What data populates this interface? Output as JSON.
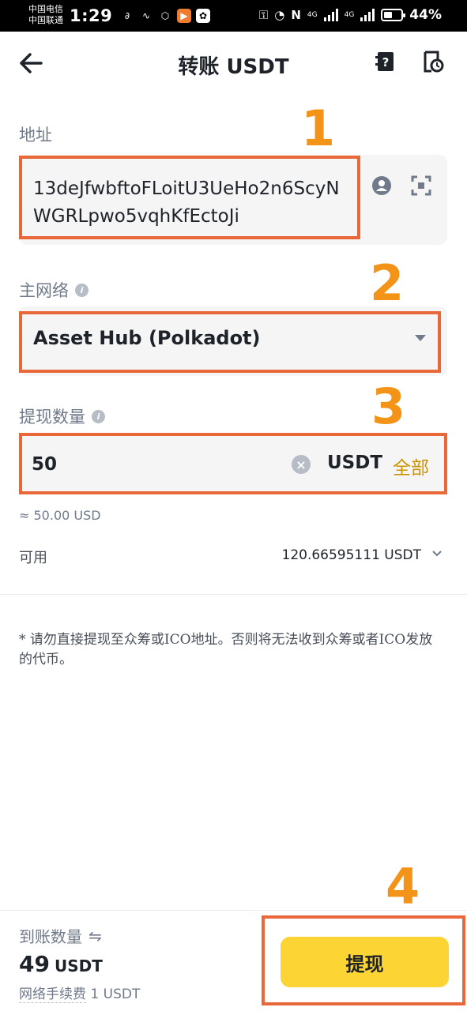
{
  "status_bar": {
    "carrier_1": "中国电信",
    "carrier_2": "中国联通",
    "time": "1:29",
    "network_1": "4G",
    "network_2": "4G",
    "battery": "44%",
    "icons": [
      "key-icon",
      "speed-icon",
      "nfc-icon",
      "signal-icon",
      "battery-icon"
    ]
  },
  "header": {
    "title": "转账 USDT",
    "back_icon": "arrow-left-icon",
    "faq_icon": "question-book-icon",
    "history_icon": "history-icon"
  },
  "address": {
    "label": "地址",
    "value": "13deJfwbftoFLoitU3UeHo2n6ScyNWGRLpwo5vqhKfEctoJi"
  },
  "network": {
    "label": "主网络",
    "value": "Asset Hub (Polkadot)"
  },
  "amount": {
    "label": "提现数量",
    "value": "50",
    "unit": "USDT",
    "max_label": "全部",
    "usd_approx": "≈ 50.00 USD"
  },
  "available": {
    "label": "可用",
    "value": "120.66595111 USDT"
  },
  "notice": "* 请勿直接提现至众筹或ICO地址。否则将无法收到众筹或者ICO发放的代币。",
  "footer": {
    "receive_label": "到账数量",
    "receive_amount": "49",
    "receive_unit": "USDT",
    "fee_label": "网络手续费",
    "fee_value": "1 USDT",
    "submit_label": "提现"
  },
  "annotations": [
    "1",
    "2",
    "3",
    "4"
  ],
  "colors": {
    "accent": "#fcd535",
    "link_gold": "#c99400",
    "annotation_border": "#e8683a",
    "annotation_number": "#f39419"
  }
}
